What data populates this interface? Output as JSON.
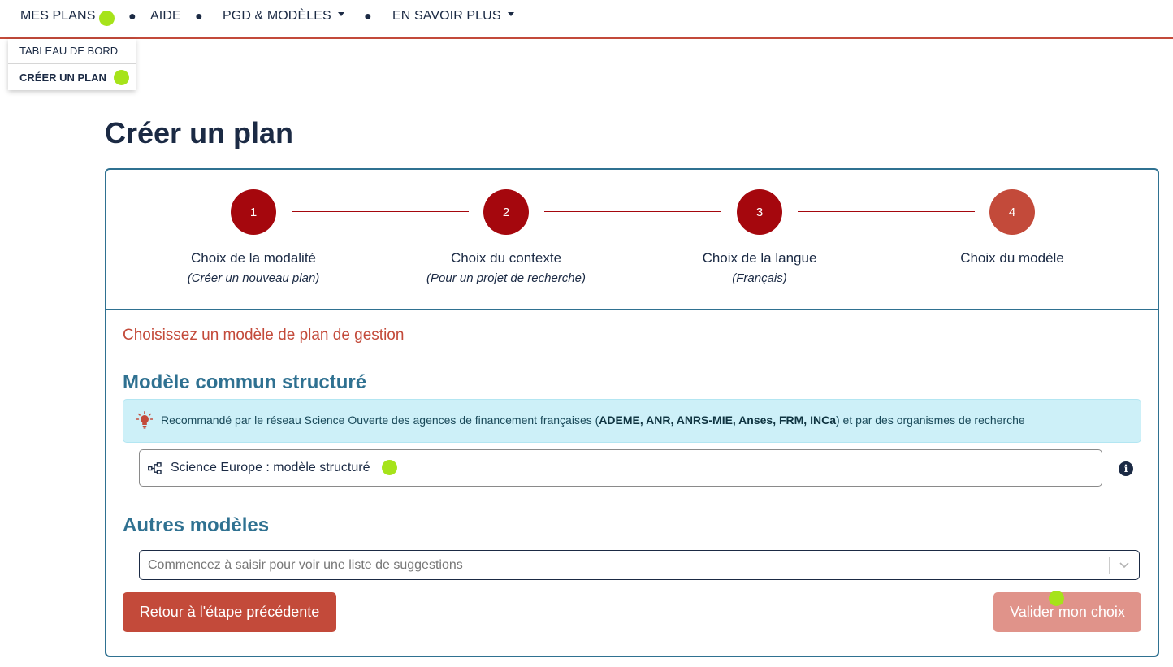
{
  "nav": {
    "items": [
      {
        "label": "MES PLANS"
      },
      {
        "label": "AIDE"
      },
      {
        "label": "PGD & MODÈLES"
      },
      {
        "label": "EN SAVOIR PLUS"
      }
    ],
    "separator": "●",
    "dropdown": {
      "items": [
        {
          "label": "TABLEAU DE BORD"
        },
        {
          "label": "CRÉER UN PLAN"
        }
      ]
    }
  },
  "page": {
    "title": "Créer un plan"
  },
  "steps": [
    {
      "number": "1",
      "label": "Choix de la modalité",
      "sub": "(Créer un nouveau plan)"
    },
    {
      "number": "2",
      "label": "Choix du contexte",
      "sub": "(Pour un projet de recherche)"
    },
    {
      "number": "3",
      "label": "Choix de la langue",
      "sub": "(Français)"
    },
    {
      "number": "4",
      "label": "Choix du modèle",
      "sub": ""
    }
  ],
  "form": {
    "prompt": "Choisissez un modèle de plan de gestion",
    "structured_title": "Modèle commun structuré",
    "alert": {
      "icon": "lightbulb-icon",
      "text_before": "Recommandé par le réseau Science Ouverte des agences de financement françaises (",
      "agencies": "ADEME, ANR, ANRS-MIE, Anses, FRM, INCa",
      "text_after": ") et par des organismes de recherche"
    },
    "structured_option": {
      "icon": "structure-tree-icon",
      "label": "Science Europe : modèle structuré"
    },
    "info_icon": "i",
    "other_title": "Autres modèles",
    "search": {
      "value": "",
      "placeholder": "Commencez à saisir pour voir une liste de suggestions"
    },
    "back_button": "Retour à l'étape précédente",
    "validate_button": "Valider mon choix"
  },
  "colors": {
    "primary_navy": "#1b2a44",
    "accent_red": "#c34a3a",
    "step_done": "#a5070d",
    "teal": "#2f7191",
    "alert_bg": "#cdf0f8",
    "marker_green": "#a6e31a"
  }
}
